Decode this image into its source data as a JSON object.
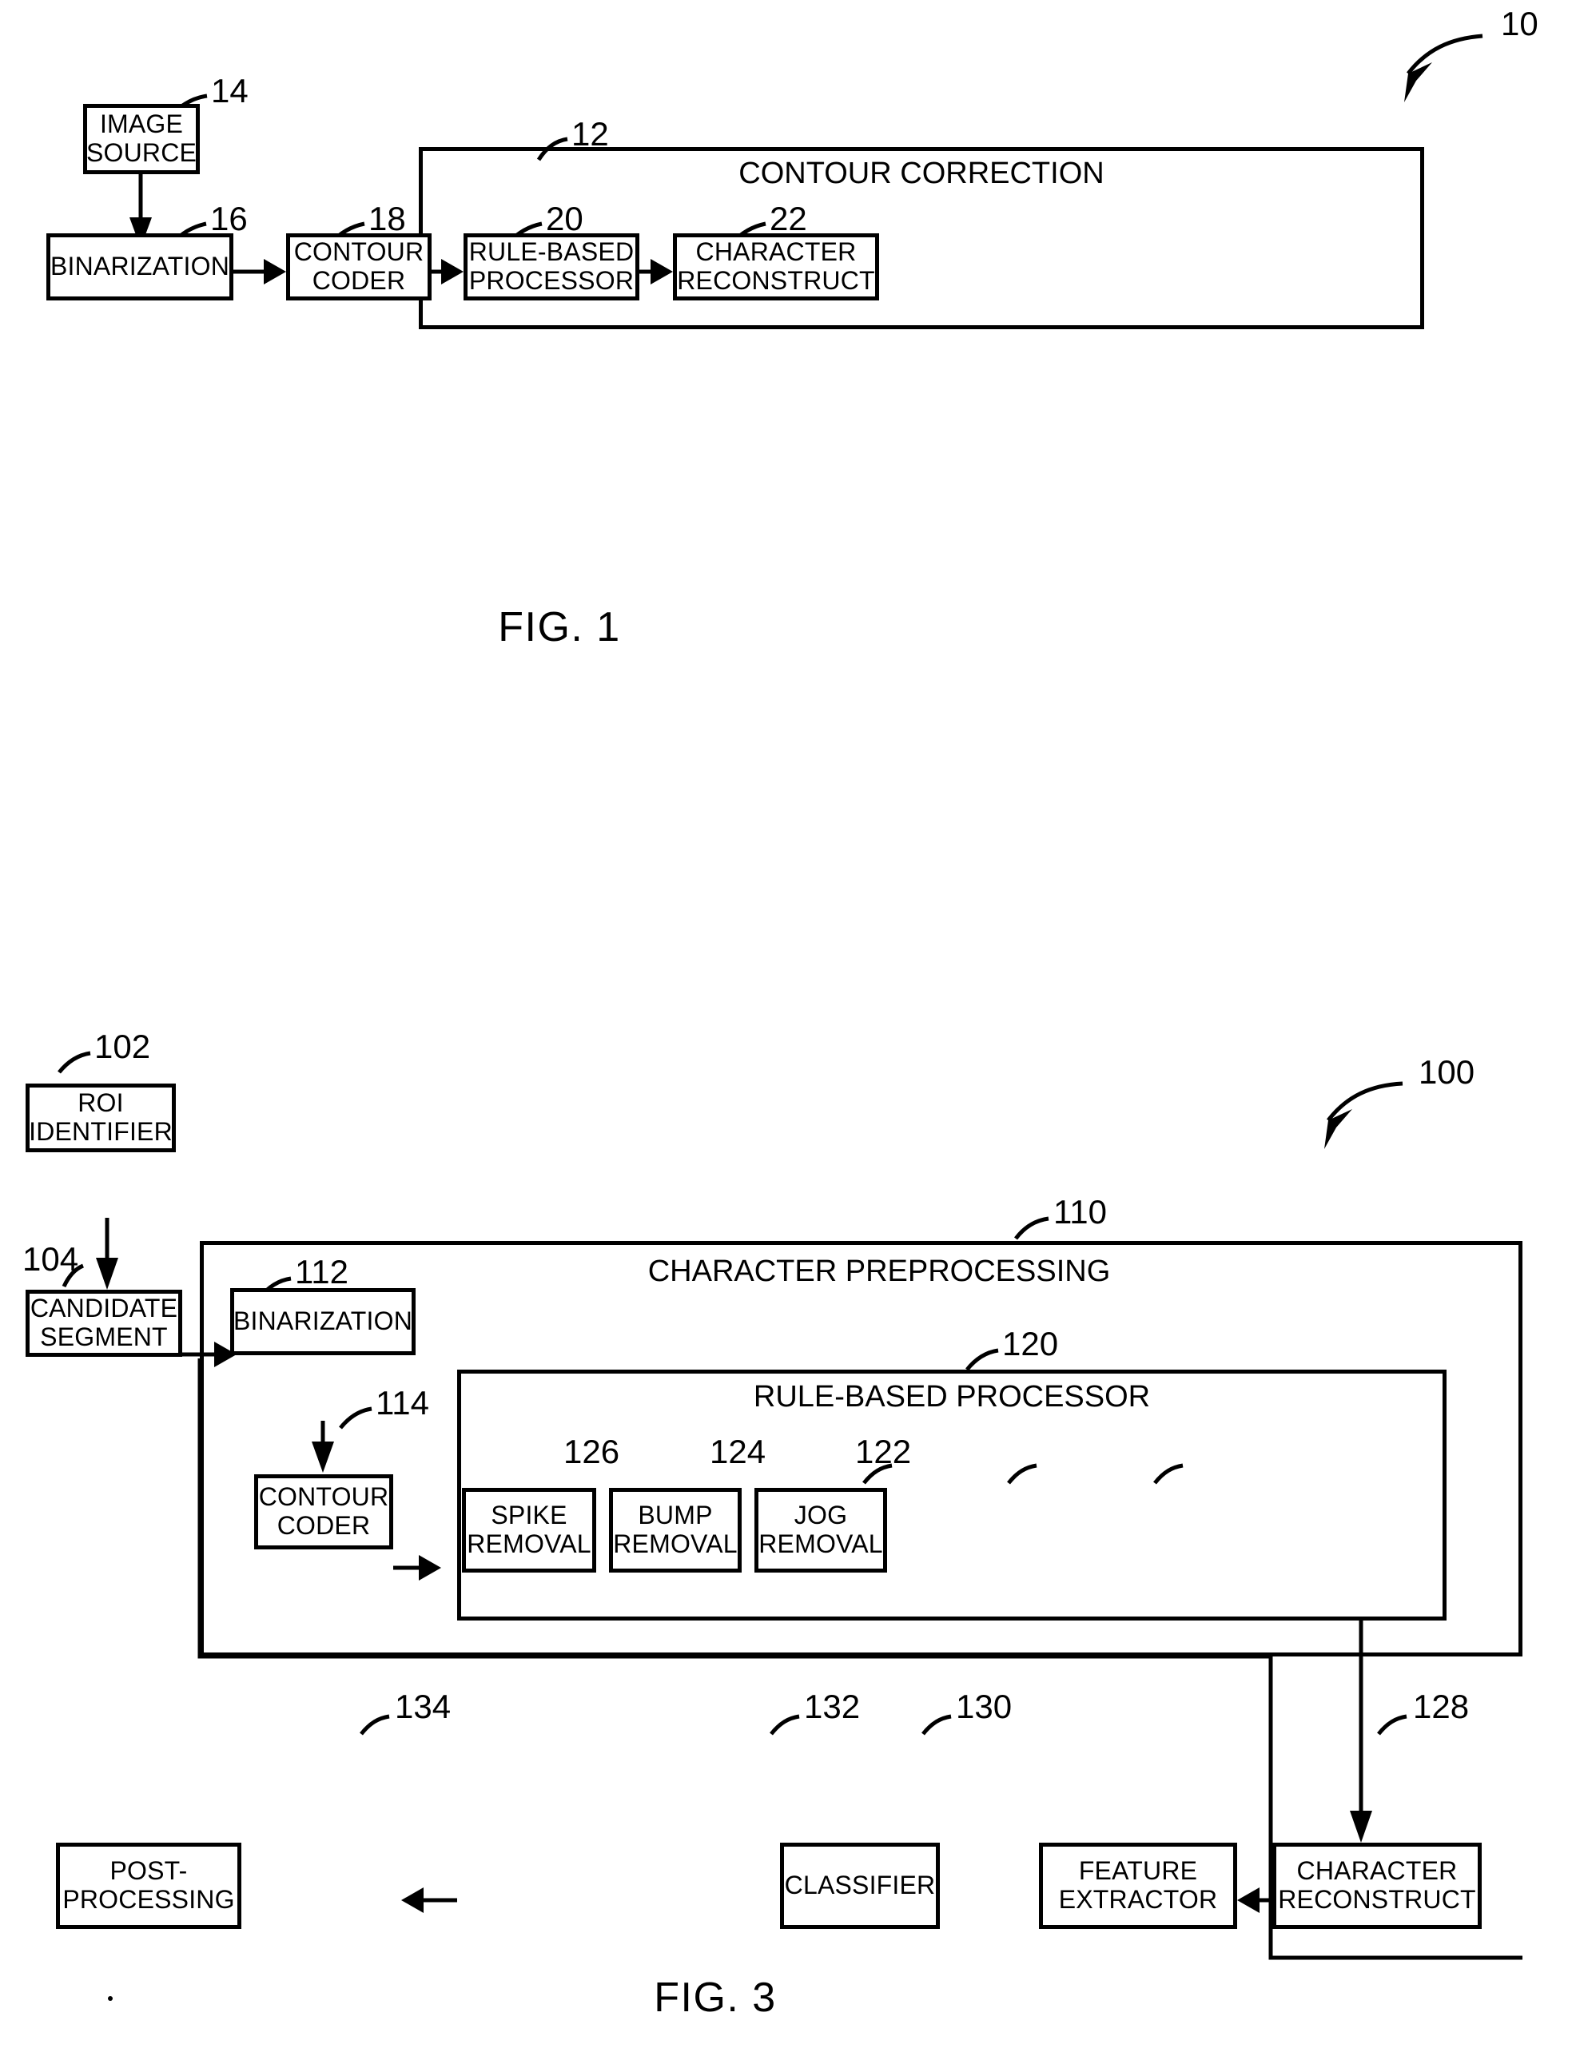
{
  "figures": [
    {
      "id": "fig1",
      "caption": "FIG. 1",
      "system_ref": "10",
      "nodes": [
        {
          "key": "image_source",
          "lines": [
            "IMAGE",
            "SOURCE"
          ],
          "ref": "14"
        },
        {
          "key": "binarization",
          "lines": [
            "BINARIZATION"
          ],
          "ref": "16"
        },
        {
          "key": "contour_coder",
          "lines": [
            "CONTOUR",
            "CODER"
          ],
          "ref": "18"
        },
        {
          "key": "rule_based_processor",
          "lines": [
            "RULE-BASED",
            "PROCESSOR"
          ],
          "ref": "20"
        },
        {
          "key": "character_reconstruct",
          "lines": [
            "CHARACTER",
            "RECONSTRUCT"
          ],
          "ref": "22"
        }
      ],
      "groups": [
        {
          "key": "contour_correction",
          "title": "CONTOUR CORRECTION",
          "ref": "12"
        }
      ]
    },
    {
      "id": "fig3",
      "caption": "FIG. 3",
      "system_ref": "100",
      "nodes": [
        {
          "key": "roi_identifier",
          "lines": [
            "ROI",
            "IDENTIFIER"
          ],
          "ref": "102"
        },
        {
          "key": "candidate_segment",
          "lines": [
            "CANDIDATE",
            "SEGMENT"
          ],
          "ref": "104"
        },
        {
          "key": "binarization",
          "lines": [
            "BINARIZATION"
          ],
          "ref": "112"
        },
        {
          "key": "contour_coder",
          "lines": [
            "CONTOUR",
            "CODER"
          ],
          "ref": "114"
        },
        {
          "key": "spike_removal",
          "lines": [
            "SPIKE",
            "REMOVAL"
          ],
          "ref": "126"
        },
        {
          "key": "bump_removal",
          "lines": [
            "BUMP",
            "REMOVAL"
          ],
          "ref": "124"
        },
        {
          "key": "jog_removal",
          "lines": [
            "JOG",
            "REMOVAL"
          ],
          "ref": "122"
        },
        {
          "key": "character_reconstruct",
          "lines": [
            "CHARACTER",
            "RECONSTRUCT"
          ],
          "ref": "128"
        },
        {
          "key": "feature_extractor",
          "lines": [
            "FEATURE",
            "EXTRACTOR"
          ],
          "ref": "130"
        },
        {
          "key": "classifier",
          "lines": [
            "CLASSIFIER"
          ],
          "ref": "132"
        },
        {
          "key": "post_processing",
          "lines": [
            "POST-",
            "PROCESSING"
          ],
          "ref": "134"
        }
      ],
      "groups": [
        {
          "key": "character_preprocessing",
          "title": "CHARACTER PREPROCESSING",
          "ref": "110"
        },
        {
          "key": "rule_based_processor",
          "title": "RULE-BASED PROCESSOR",
          "ref": "120"
        }
      ]
    }
  ],
  "fig1": {
    "caption": "FIG. 1",
    "system_ref": "10",
    "group_contour_correction": {
      "title": "CONTOUR CORRECTION",
      "ref": "12"
    },
    "image_source": {
      "l1": "IMAGE",
      "l2": "SOURCE",
      "ref": "14"
    },
    "binarization": {
      "l1": "BINARIZATION",
      "ref": "16"
    },
    "contour_coder": {
      "l1": "CONTOUR",
      "l2": "CODER",
      "ref": "18"
    },
    "rule_based_processor": {
      "l1": "RULE-BASED",
      "l2": "PROCESSOR",
      "ref": "20"
    },
    "character_reconstruct": {
      "l1": "CHARACTER",
      "l2": "RECONSTRUCT",
      "ref": "22"
    }
  },
  "fig3": {
    "caption": "FIG. 3",
    "system_ref": "100",
    "group_character_preprocessing": {
      "title": "CHARACTER PREPROCESSING",
      "ref": "110"
    },
    "group_rule_based_processor": {
      "title": "RULE-BASED PROCESSOR",
      "ref": "120"
    },
    "roi_identifier": {
      "l1": "ROI",
      "l2": "IDENTIFIER",
      "ref": "102"
    },
    "candidate_segment": {
      "l1": "CANDIDATE",
      "l2": "SEGMENT",
      "ref": "104"
    },
    "binarization": {
      "l1": "BINARIZATION",
      "ref": "112"
    },
    "contour_coder": {
      "l1": "CONTOUR",
      "l2": "CODER",
      "ref": "114"
    },
    "spike_removal": {
      "l1": "SPIKE",
      "l2": "REMOVAL",
      "ref": "126"
    },
    "bump_removal": {
      "l1": "BUMP",
      "l2": "REMOVAL",
      "ref": "124"
    },
    "jog_removal": {
      "l1": "JOG",
      "l2": "REMOVAL",
      "ref": "122"
    },
    "character_reconstruct": {
      "l1": "CHARACTER",
      "l2": "RECONSTRUCT",
      "ref": "128"
    },
    "feature_extractor": {
      "l1": "FEATURE",
      "l2": "EXTRACTOR",
      "ref": "130"
    },
    "classifier": {
      "l1": "CLASSIFIER",
      "ref": "132"
    },
    "post_processing": {
      "l1": "POST-",
      "l2": "PROCESSING",
      "ref": "134"
    }
  },
  "colors": {
    "ink": "#000000",
    "paper": "#ffffff"
  }
}
